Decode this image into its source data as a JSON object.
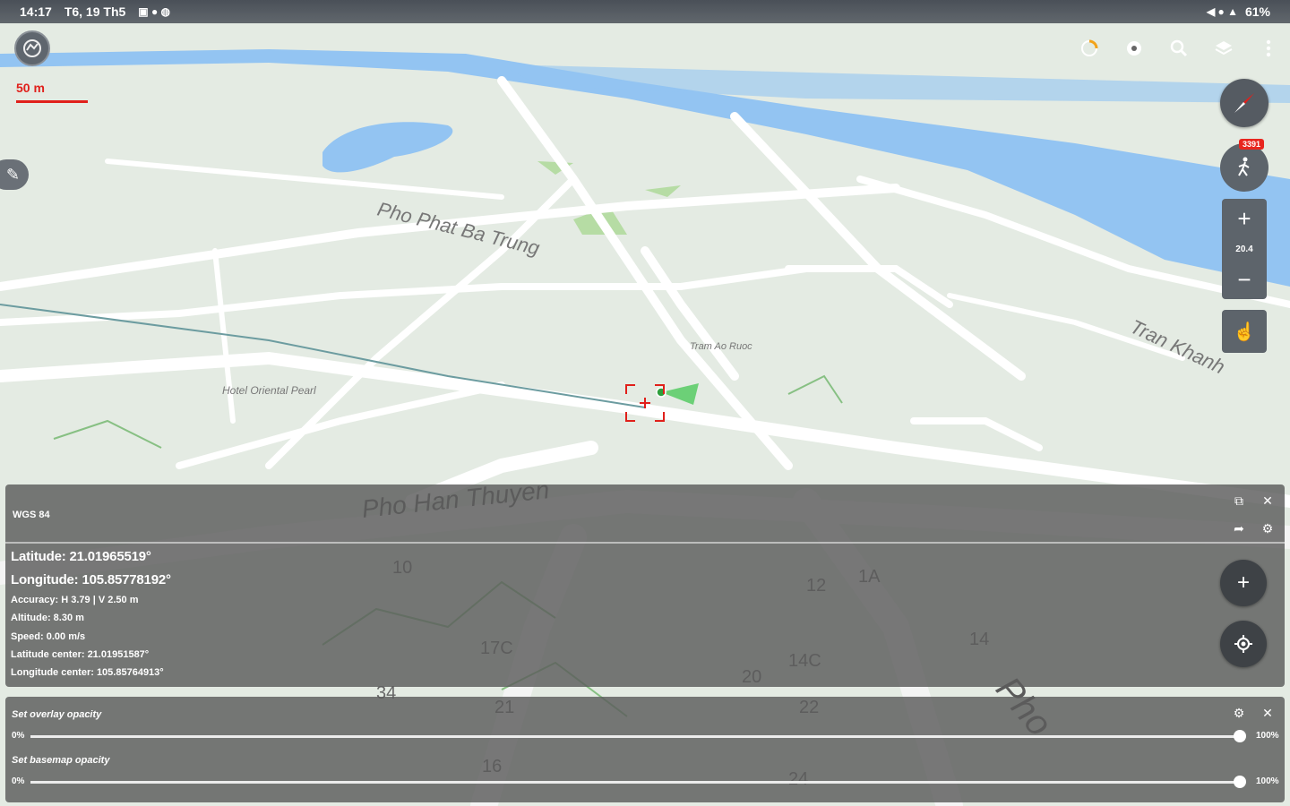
{
  "status_bar": {
    "time": "14:17",
    "date": "T6, 19 Th5",
    "battery": "61%"
  },
  "map": {
    "scale_label": "50 m",
    "zoom_level": "20.4",
    "gps_badge": "3391",
    "street_labels": [
      "Pho Phat Ba Trung",
      "Pho Han Thuyen",
      "Tran Khanh",
      "Pho",
      "Hotel Oriental Pearl",
      "Tram Ao Ruoc"
    ],
    "house_numbers": [
      "12",
      "1A",
      "14",
      "14C",
      "20",
      "22",
      "21",
      "16",
      "17C",
      "10",
      "34",
      "24"
    ]
  },
  "info_panel": {
    "title": "WGS 84",
    "latitude": "Latitude: 21.01965519°",
    "longitude": "Longitude: 105.85778192°",
    "accuracy": "Accuracy: H 3.79 | V 2.50 m",
    "altitude": "Altitude: 8.30 m",
    "speed": "Speed: 0.00 m/s",
    "latitude_center": "Latitude center: 21.01951587°",
    "longitude_center": "Longitude center: 105.85764913°"
  },
  "opacity_panel": {
    "overlay_label": "Set overlay opacity",
    "overlay_min": "0%",
    "overlay_max": "100%",
    "overlay_value": 1.0,
    "basemap_label": "Set basemap opacity",
    "basemap_min": "0%",
    "basemap_max": "100%",
    "basemap_value": 1.0
  },
  "colors": {
    "water": "#93c4f2",
    "park": "#b6dca4",
    "road": "#ffffff",
    "land": "#e4ebe3",
    "scale": "#e0201b"
  },
  "icons": [
    "app-logo-icon",
    "measure-icon",
    "settings-icon",
    "search-icon",
    "layers-icon",
    "more-icon",
    "edit-icon",
    "compass-icon",
    "gps-walk-icon",
    "zoom-in-icon",
    "zoom-out-icon",
    "touch-icon",
    "copy-icon",
    "close-icon",
    "share-icon",
    "add-icon",
    "locate-icon"
  ]
}
